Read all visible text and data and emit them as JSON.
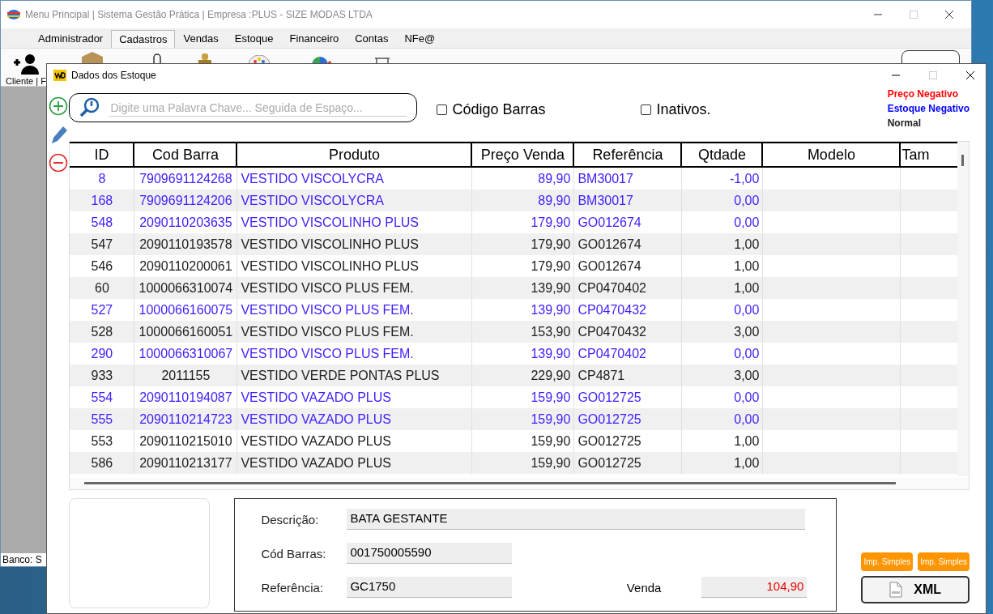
{
  "main_window": {
    "title": "Menu Principal | Sistema Gestão Prática | Empresa :PLUS - SIZE MODAS LTDA",
    "menu_tabs": [
      {
        "label": "Administrador",
        "selected": false
      },
      {
        "label": "Cadastros",
        "selected": true
      },
      {
        "label": "Vendas",
        "selected": false
      },
      {
        "label": "Estoque",
        "selected": false
      },
      {
        "label": "Financeiro",
        "selected": false
      },
      {
        "label": "Contas",
        "selected": false
      },
      {
        "label": "NFe@",
        "selected": false
      }
    ],
    "toolbar_label": "Cliente | F",
    "status_bar": "Banco: S"
  },
  "dialog": {
    "title": "Dados dos Estoque",
    "search": {
      "placeholder": "Digite uma Palavra Chave... Seguida de Espaço..."
    },
    "checkboxes": [
      {
        "label": "Código Barras",
        "checked": false
      },
      {
        "label": "Inativos.",
        "checked": false
      }
    ],
    "legend": [
      {
        "label": "Preço Negativo",
        "color": "#ff0000"
      },
      {
        "label": "Estoque Negativo",
        "color": "#0000ff"
      },
      {
        "label": "Normal",
        "color": "#202020"
      }
    ],
    "table": {
      "columns": [
        "ID",
        "Cod Barra",
        "Produto",
        "Preço Venda",
        "Referência",
        "Qtdade",
        "Modelo",
        "Tam"
      ],
      "rows": [
        {
          "color": "#3c1eff",
          "cells": [
            "8",
            "7909691124268",
            "VESTIDO VISCOLYCRA",
            "89,90",
            "BM30017",
            "-1,00",
            ""
          ]
        },
        {
          "color": "#3c1eff",
          "cells": [
            "168",
            "7909691124206",
            "VESTIDO VISCOLYCRA",
            "89,90",
            "BM30017",
            "0,00",
            ""
          ]
        },
        {
          "color": "#3c1eff",
          "cells": [
            "548",
            "2090110203635",
            "VESTIDO VISCOLINHO PLUS",
            "179,90",
            "GO012674",
            "0,00",
            ""
          ]
        },
        {
          "color": "#202020",
          "cells": [
            "547",
            "2090110193578",
            "VESTIDO VISCOLINHO PLUS",
            "179,90",
            "GO012674",
            "1,00",
            ""
          ]
        },
        {
          "color": "#202020",
          "cells": [
            "546",
            "2090110200061",
            "VESTIDO VISCOLINHO PLUS",
            "179,90",
            "GO012674",
            "1,00",
            ""
          ]
        },
        {
          "color": "#202020",
          "cells": [
            "60",
            "1000066310074",
            "VESTIDO VISCO PLUS FEM.",
            "139,90",
            "CP0470402",
            "1,00",
            ""
          ]
        },
        {
          "color": "#3c1eff",
          "cells": [
            "527",
            "1000066160075",
            "VESTIDO VISCO PLUS FEM.",
            "139,90",
            "CP0470432",
            "0,00",
            ""
          ]
        },
        {
          "color": "#202020",
          "cells": [
            "528",
            "1000066160051",
            "VESTIDO VISCO PLUS FEM.",
            "153,90",
            "CP0470432",
            "3,00",
            ""
          ]
        },
        {
          "color": "#3c1eff",
          "cells": [
            "290",
            "1000066310067",
            "VESTIDO VISCO PLUS FEM.",
            "139,90",
            "CP0470402",
            "0,00",
            ""
          ]
        },
        {
          "color": "#202020",
          "cells": [
            "933",
            "2011155",
            "VESTIDO VERDE PONTAS PLUS",
            "229,90",
            "CP4871",
            "3,00",
            ""
          ]
        },
        {
          "color": "#3c1eff",
          "cells": [
            "554",
            "2090110194087",
            "VESTIDO VAZADO PLUS",
            "159,90",
            "GO012725",
            "0,00",
            ""
          ]
        },
        {
          "color": "#3c1eff",
          "cells": [
            "555",
            "2090110214723",
            "VESTIDO VAZADO PLUS",
            "159,90",
            "GO012725",
            "0,00",
            ""
          ]
        },
        {
          "color": "#202020",
          "cells": [
            "553",
            "2090110215010",
            "VESTIDO VAZADO PLUS",
            "159,90",
            "GO012725",
            "1,00",
            ""
          ]
        },
        {
          "color": "#202020",
          "cells": [
            "586",
            "2090110213177",
            "VESTIDO VAZADO PLUS",
            "159,90",
            "GO012725",
            "1,00",
            ""
          ]
        }
      ]
    },
    "details": [
      {
        "label": "Descrição:",
        "value": "BATA GESTANTE"
      },
      {
        "label": "Cód Barras:",
        "value": "001750005590"
      },
      {
        "label": "Referência:",
        "value": "GC1750"
      }
    ],
    "sale": {
      "label": "Venda",
      "value": "104,90"
    },
    "print_buttons": [
      "Imp. Simples",
      "Imp. Simples"
    ],
    "xml_button": "XML"
  }
}
